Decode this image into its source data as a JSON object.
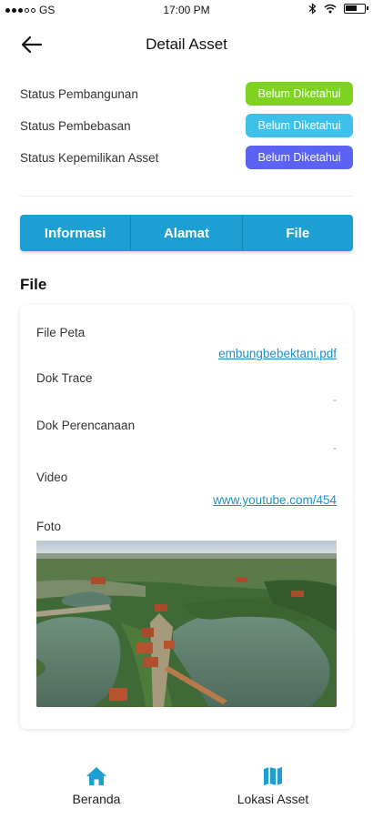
{
  "statusbar": {
    "carrier": "GS",
    "time": "17:00 PM"
  },
  "header": {
    "title": "Detail Asset"
  },
  "statuses": [
    {
      "label": "Status Pembangunan",
      "badge": "Belum Diketahui",
      "color": "#7ed321"
    },
    {
      "label": "Status Pembebasan",
      "badge": "Belum Diketahui",
      "color": "#3ec1e8"
    },
    {
      "label": "Status Kepemilikan Asset",
      "badge": "Belum Diketahui",
      "color": "#5b63f3"
    }
  ],
  "tabs": [
    {
      "label": "Informasi"
    },
    {
      "label": "Alamat"
    },
    {
      "label": "File"
    }
  ],
  "section": {
    "title": "File"
  },
  "file_card": {
    "file_peta": {
      "label": "File Peta",
      "value": "embungbebektani.pdf"
    },
    "dok_trace": {
      "label": "Dok Trace",
      "value": "-"
    },
    "dok_perencanaan": {
      "label": "Dok Perencanaan",
      "value": "-"
    },
    "video": {
      "label": "Video",
      "value": "www.youtube.com/454"
    },
    "foto": {
      "label": "Foto"
    }
  },
  "bottom_nav": {
    "home": {
      "label": "Beranda",
      "icon": "home-icon"
    },
    "location": {
      "label": "Lokasi Asset",
      "icon": "map-icon"
    }
  },
  "colors": {
    "accent": "#1e9fd3",
    "link": "#1e8fc4"
  }
}
